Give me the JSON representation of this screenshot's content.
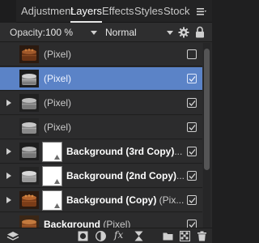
{
  "tabs": [
    {
      "label": "Adjustment",
      "active": false
    },
    {
      "label": "Layers",
      "active": true
    },
    {
      "label": "Effects",
      "active": false
    },
    {
      "label": "Styles",
      "active": false
    },
    {
      "label": "Stock",
      "active": false
    }
  ],
  "options": {
    "opacity_label": "Opacity:",
    "opacity_value": "100 %",
    "blend_mode": "Normal"
  },
  "layers": [
    {
      "name_bold": "",
      "name_rest": "(Pixel)",
      "selected": false,
      "visible": false,
      "expandable": false,
      "has_mask": false,
      "thumb": "color"
    },
    {
      "name_bold": "",
      "name_rest": "(Pixel)",
      "selected": true,
      "visible": true,
      "expandable": false,
      "has_mask": false,
      "thumb": "bw"
    },
    {
      "name_bold": "",
      "name_rest": "(Pixel)",
      "selected": false,
      "visible": true,
      "expandable": true,
      "has_mask": false,
      "thumb": "bw"
    },
    {
      "name_bold": "",
      "name_rest": "(Pixel)",
      "selected": false,
      "visible": true,
      "expandable": false,
      "has_mask": false,
      "thumb": "bw"
    },
    {
      "name_bold": "Background (3rd Copy)",
      "name_rest": "...",
      "selected": false,
      "visible": true,
      "expandable": true,
      "has_mask": true,
      "thumb": "bw"
    },
    {
      "name_bold": "Background (2nd Copy)",
      "name_rest": "...",
      "selected": false,
      "visible": true,
      "expandable": true,
      "has_mask": true,
      "thumb": "bw"
    },
    {
      "name_bold": "Background (Copy)",
      "name_rest": " (Pix...",
      "selected": false,
      "visible": true,
      "expandable": true,
      "has_mask": true,
      "thumb": "color"
    },
    {
      "name_bold": "Background",
      "name_rest": " (Pixel)",
      "selected": false,
      "visible": true,
      "expandable": false,
      "has_mask": false,
      "thumb": "color"
    }
  ],
  "toolbar": {
    "fx_label": "fx"
  },
  "colors": {
    "selection": "#5b83c7",
    "panel_bg": "#2a2a2b"
  }
}
